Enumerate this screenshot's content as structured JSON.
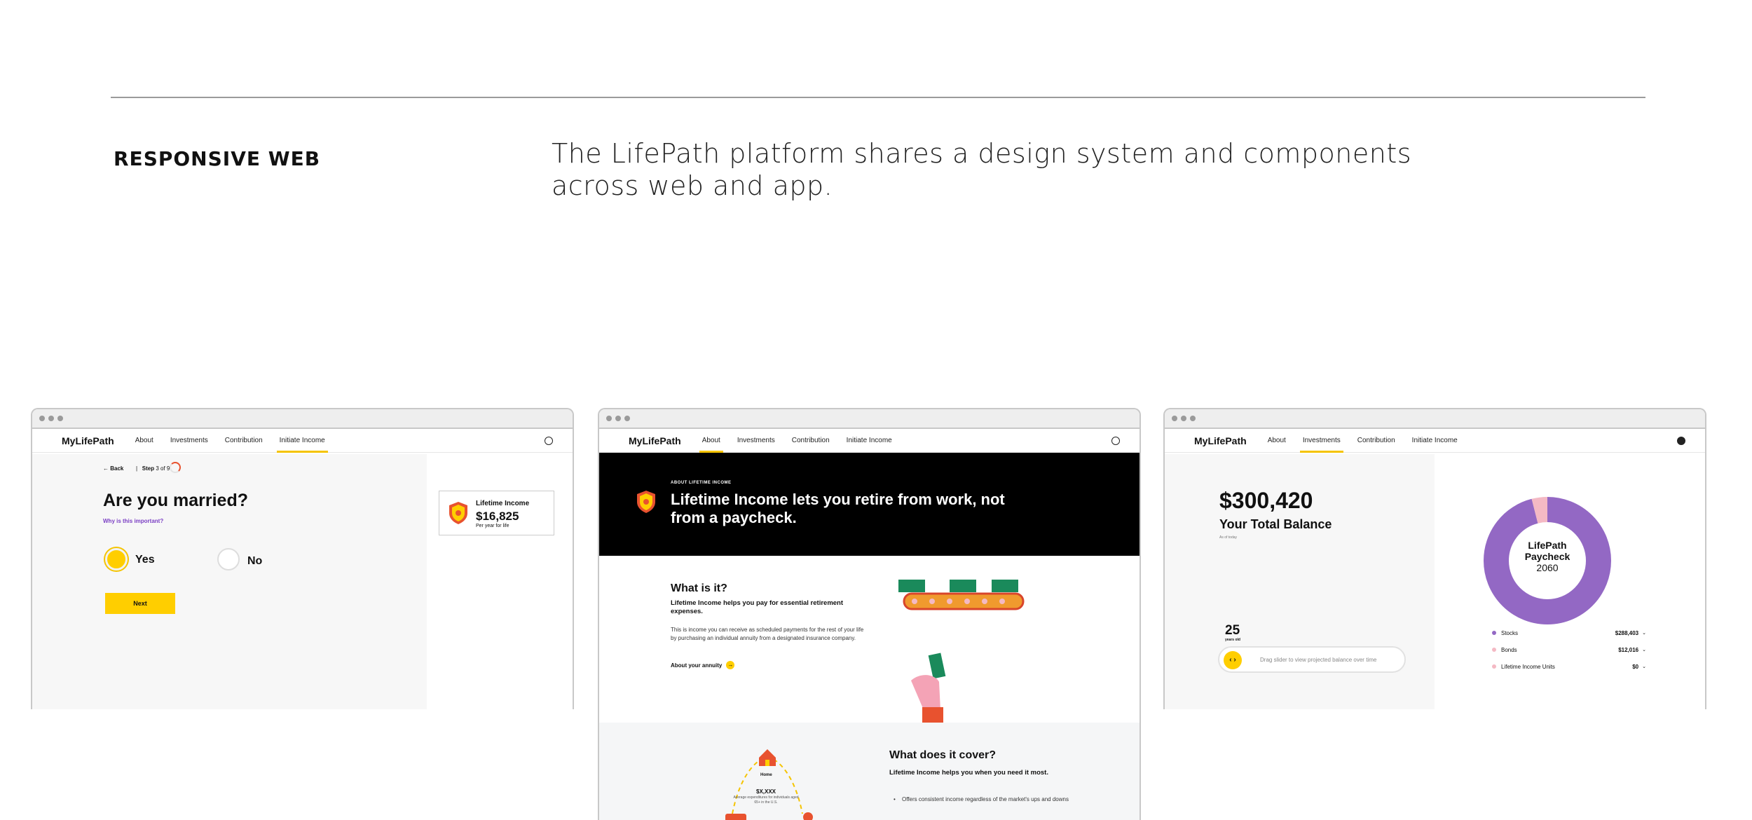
{
  "header": {
    "section_label": "RESPONSIVE WEB",
    "description": "The LifePath platform shares a design system and components across web and app."
  },
  "colors": {
    "accent": "#FFCE00",
    "purple": "#9368C4",
    "pink": "#F4B9C4",
    "link": "#7B3FC4"
  },
  "nav": {
    "brand": "MyLifePath",
    "items": [
      "About",
      "Investments",
      "Contribution",
      "Initiate Income"
    ]
  },
  "window1": {
    "back": "Back",
    "step_prefix": "Step",
    "step_value": "3 of 9",
    "question": "Are you married?",
    "why": "Why is this important?",
    "option_yes": "Yes",
    "option_no": "No",
    "selected": "Yes",
    "next_button": "Next",
    "card": {
      "title": "Lifetime Income",
      "value": "$16,825",
      "sub": "Per year for life"
    }
  },
  "window2": {
    "hero": {
      "kicker": "ABOUT LIFETIME INCOME",
      "title": "Lifetime Income lets you retire from work, not from a paycheck."
    },
    "what_is_it": {
      "title": "What is it?",
      "subtitle": "Lifetime Income helps you pay for essential retirement expenses.",
      "body": "This is income you can receive as scheduled payments for the rest of your life by purchasing an individual annuity from a designated insurance company.",
      "link": "About your annuity"
    },
    "what_cover": {
      "title": "What does it cover?",
      "subtitle": "Lifetime Income helps you when you need it most.",
      "bullet": "Offers consistent income regardless of the market's ups and downs",
      "home_label": "Home",
      "home_value": "$X,XXX",
      "home_desc": "Average expenditures for individuals aged 65+ in the U.S."
    }
  },
  "window3": {
    "balance": "$300,420",
    "balance_label": "Your Total Balance",
    "as_of": "As of today",
    "age": "25",
    "age_label": "years old",
    "slider_hint": "Drag slider to view projected balance over time",
    "donut": {
      "line1": "LifePath",
      "line2": "Paycheck",
      "line3": "2060"
    },
    "legend": [
      {
        "name": "Stocks",
        "value": "$288,403",
        "color": "#9368C4"
      },
      {
        "name": "Bonds",
        "value": "$12,016",
        "color": "#F4B9C4"
      },
      {
        "name": "Lifetime Income Units",
        "value": "$0",
        "color": "#F4B9C4"
      }
    ],
    "allocation": [
      {
        "name": "Stocks",
        "amount": 288403
      },
      {
        "name": "Bonds",
        "amount": 12016
      },
      {
        "name": "Lifetime Income Units",
        "amount": 0
      }
    ]
  }
}
